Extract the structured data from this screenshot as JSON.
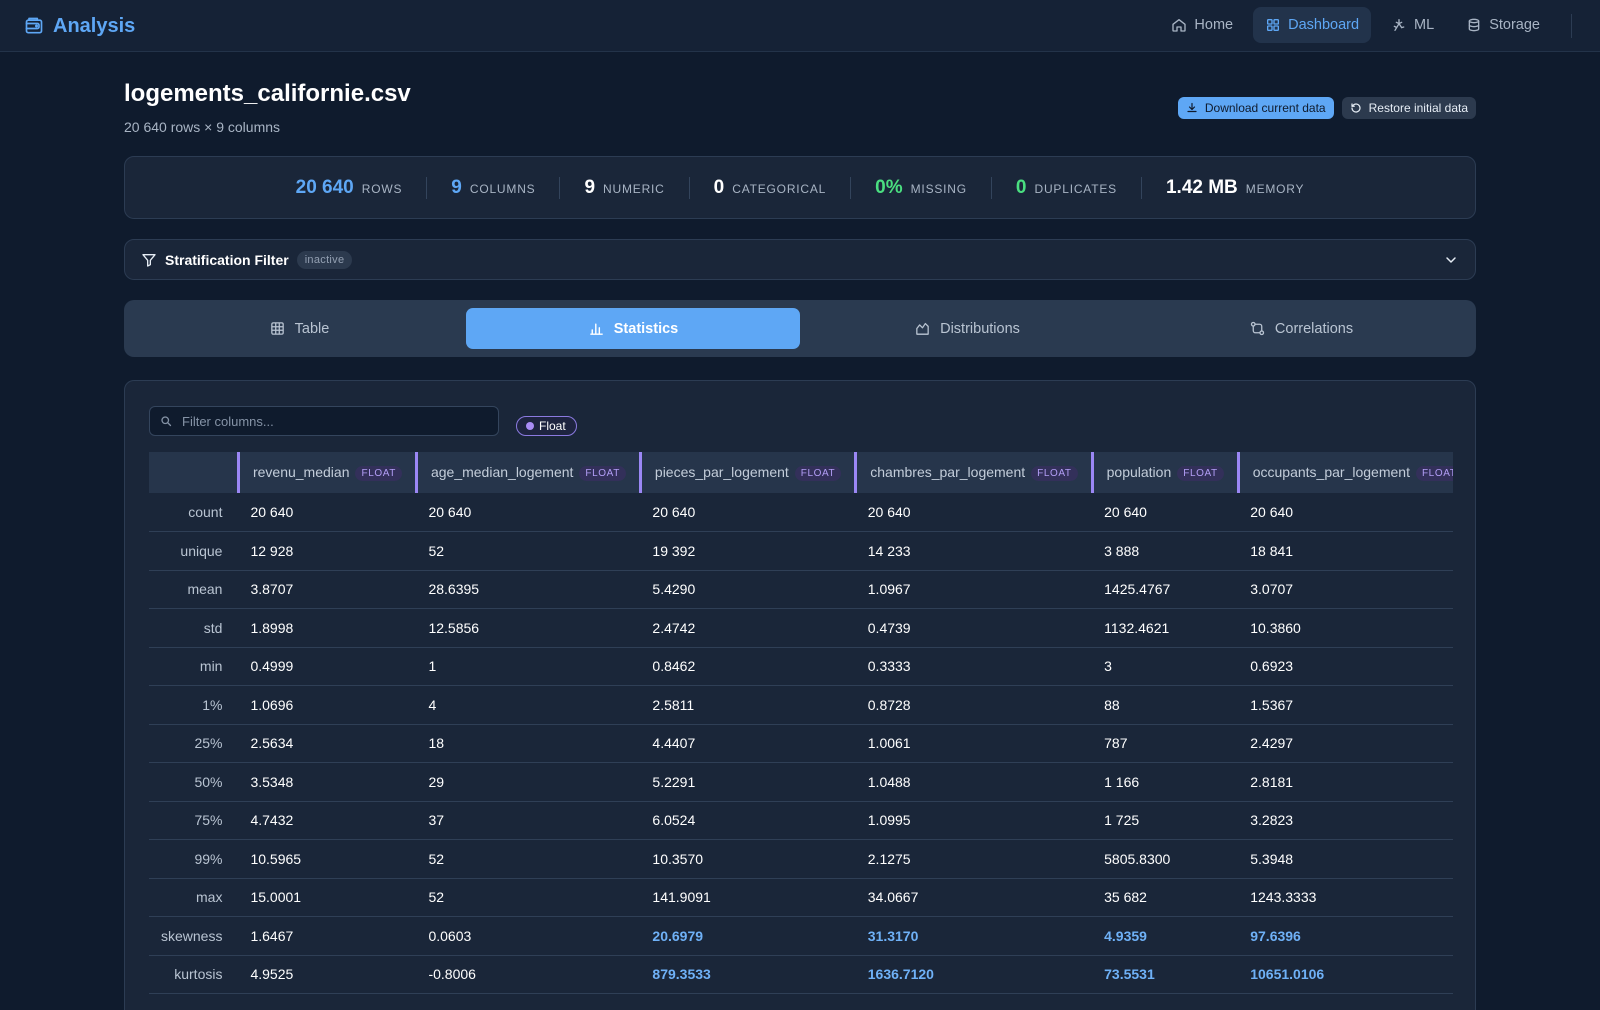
{
  "app": {
    "title": "Analysis",
    "nav": [
      {
        "label": "Home",
        "icon": "home-icon",
        "active": false
      },
      {
        "label": "Dashboard",
        "icon": "dashboard-icon",
        "active": true
      },
      {
        "label": "ML",
        "icon": "ml-icon",
        "active": false
      },
      {
        "label": "Storage",
        "icon": "storage-icon",
        "active": false
      }
    ]
  },
  "file": {
    "name": "logements_californie.csv",
    "shape": "20 640 rows × 9 columns"
  },
  "actions": {
    "download_label": "Download current data",
    "restore_label": "Restore initial data"
  },
  "summary": [
    {
      "value": "20 640",
      "label": "ROWS",
      "color": "#5ea7f5"
    },
    {
      "value": "9",
      "label": "COLUMNS",
      "color": "#5ea7f5"
    },
    {
      "value": "9",
      "label": "NUMERIC",
      "color": "#ffffff"
    },
    {
      "value": "0",
      "label": "CATEGORICAL",
      "color": "#ffffff"
    },
    {
      "value": "0%",
      "label": "MISSING",
      "color": "#4ade80"
    },
    {
      "value": "0",
      "label": "DUPLICATES",
      "color": "#4ade80"
    },
    {
      "value": "1.42 MB",
      "label": "MEMORY",
      "color": "#ffffff"
    }
  ],
  "filter": {
    "title": "Stratification Filter",
    "status": "inactive"
  },
  "tabs": [
    {
      "label": "Table",
      "icon": "table-icon",
      "active": false
    },
    {
      "label": "Statistics",
      "icon": "bar-chart-icon",
      "active": true
    },
    {
      "label": "Distributions",
      "icon": "distribution-icon",
      "active": false
    },
    {
      "label": "Correlations",
      "icon": "correlation-icon",
      "active": false
    }
  ],
  "stats": {
    "search_placeholder": "Filter columns...",
    "type_filter": "Float",
    "columns": [
      {
        "name": "revenu_median",
        "type": "FLOAT"
      },
      {
        "name": "age_median_logement",
        "type": "FLOAT"
      },
      {
        "name": "pieces_par_logement",
        "type": "FLOAT"
      },
      {
        "name": "chambres_par_logement",
        "type": "FLOAT"
      },
      {
        "name": "population",
        "type": "FLOAT"
      },
      {
        "name": "occupants_par_logement",
        "type": "FLOAT"
      }
    ],
    "rows": [
      {
        "label": "count",
        "values": [
          "20 640",
          "20 640",
          "20 640",
          "20 640",
          "20 640",
          "20 640"
        ]
      },
      {
        "label": "unique",
        "values": [
          "12 928",
          "52",
          "19 392",
          "14 233",
          "3 888",
          "18 841"
        ]
      },
      {
        "label": "mean",
        "values": [
          "3.8707",
          "28.6395",
          "5.4290",
          "1.0967",
          "1425.4767",
          "3.0707"
        ]
      },
      {
        "label": "std",
        "values": [
          "1.8998",
          "12.5856",
          "2.4742",
          "0.4739",
          "1132.4621",
          "10.3860"
        ]
      },
      {
        "label": "min",
        "values": [
          "0.4999",
          "1",
          "0.8462",
          "0.3333",
          "3",
          "0.6923"
        ]
      },
      {
        "label": "1%",
        "values": [
          "1.0696",
          "4",
          "2.5811",
          "0.8728",
          "88",
          "1.5367"
        ]
      },
      {
        "label": "25%",
        "values": [
          "2.5634",
          "18",
          "4.4407",
          "1.0061",
          "787",
          "2.4297"
        ]
      },
      {
        "label": "50%",
        "values": [
          "3.5348",
          "29",
          "5.2291",
          "1.0488",
          "1 166",
          "2.8181"
        ]
      },
      {
        "label": "75%",
        "values": [
          "4.7432",
          "37",
          "6.0524",
          "1.0995",
          "1 725",
          "3.2823"
        ]
      },
      {
        "label": "99%",
        "values": [
          "10.5965",
          "52",
          "10.3570",
          "2.1275",
          "5805.8300",
          "5.3948"
        ]
      },
      {
        "label": "max",
        "values": [
          "15.0001",
          "52",
          "141.9091",
          "34.0667",
          "35 682",
          "1243.3333"
        ]
      },
      {
        "label": "skewness",
        "values": [
          "1.6467",
          "0.0603",
          "20.6979",
          "31.3170",
          "4.9359",
          "97.6396"
        ],
        "highlight": [
          false,
          false,
          true,
          true,
          true,
          true
        ]
      },
      {
        "label": "kurtosis",
        "values": [
          "4.9525",
          "-0.8006",
          "879.3533",
          "1636.7120",
          "73.5531",
          "10651.0106"
        ],
        "highlight": [
          false,
          false,
          true,
          true,
          true,
          true
        ]
      }
    ]
  }
}
